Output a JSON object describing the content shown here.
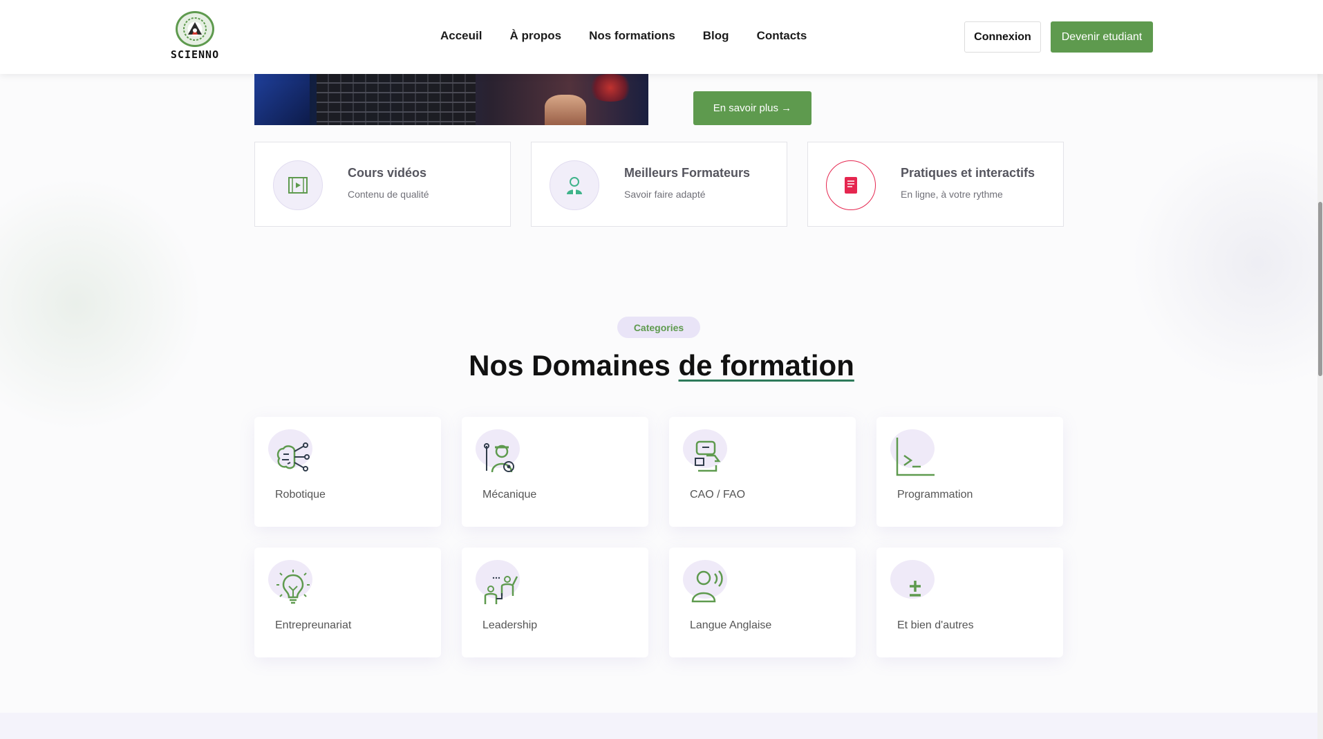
{
  "brand": {
    "name": "SCIENNO"
  },
  "nav": {
    "items": [
      "Acceuil",
      "À propos",
      "Nos formations",
      "Blog",
      "Contacts"
    ]
  },
  "header": {
    "login_label": "Connexion",
    "signup_label": "Devenir etudiant"
  },
  "hero": {
    "more_label": "En savoir plus →"
  },
  "features": [
    {
      "title": "Cours vidéos",
      "subtitle": "Contenu de qualité",
      "icon": "video-film-icon"
    },
    {
      "title": "Meilleurs Formateurs",
      "subtitle": "Savoir faire adapté",
      "icon": "trainer-icon"
    },
    {
      "title": "Pratiques et interactifs",
      "subtitle": "En ligne, à votre rythme",
      "icon": "book-icon"
    }
  ],
  "section": {
    "badge": "Categories",
    "title_main": "Nos Domaines ",
    "title_underlined": "de formation"
  },
  "categories": [
    {
      "label": "Robotique",
      "icon": "robot-brain-icon"
    },
    {
      "label": "Mécanique",
      "icon": "mechanic-icon"
    },
    {
      "label": "CAO / FAO",
      "icon": "cad-designer-icon"
    },
    {
      "label": "Programmation",
      "icon": "terminal-icon"
    },
    {
      "label": "Entrepreunariat",
      "icon": "lightbulb-icon"
    },
    {
      "label": "Leadership",
      "icon": "leadership-icon"
    },
    {
      "label": "Langue Anglaise",
      "icon": "speaking-person-icon"
    },
    {
      "label": "Et bien d'autres",
      "icon": "plus-minus-icon"
    }
  ],
  "colors": {
    "accent": "#5e9a4e",
    "badge_bg": "#e9e4f7",
    "book_icon": "#e5264f",
    "trainer_icon": "#3fb38a"
  }
}
